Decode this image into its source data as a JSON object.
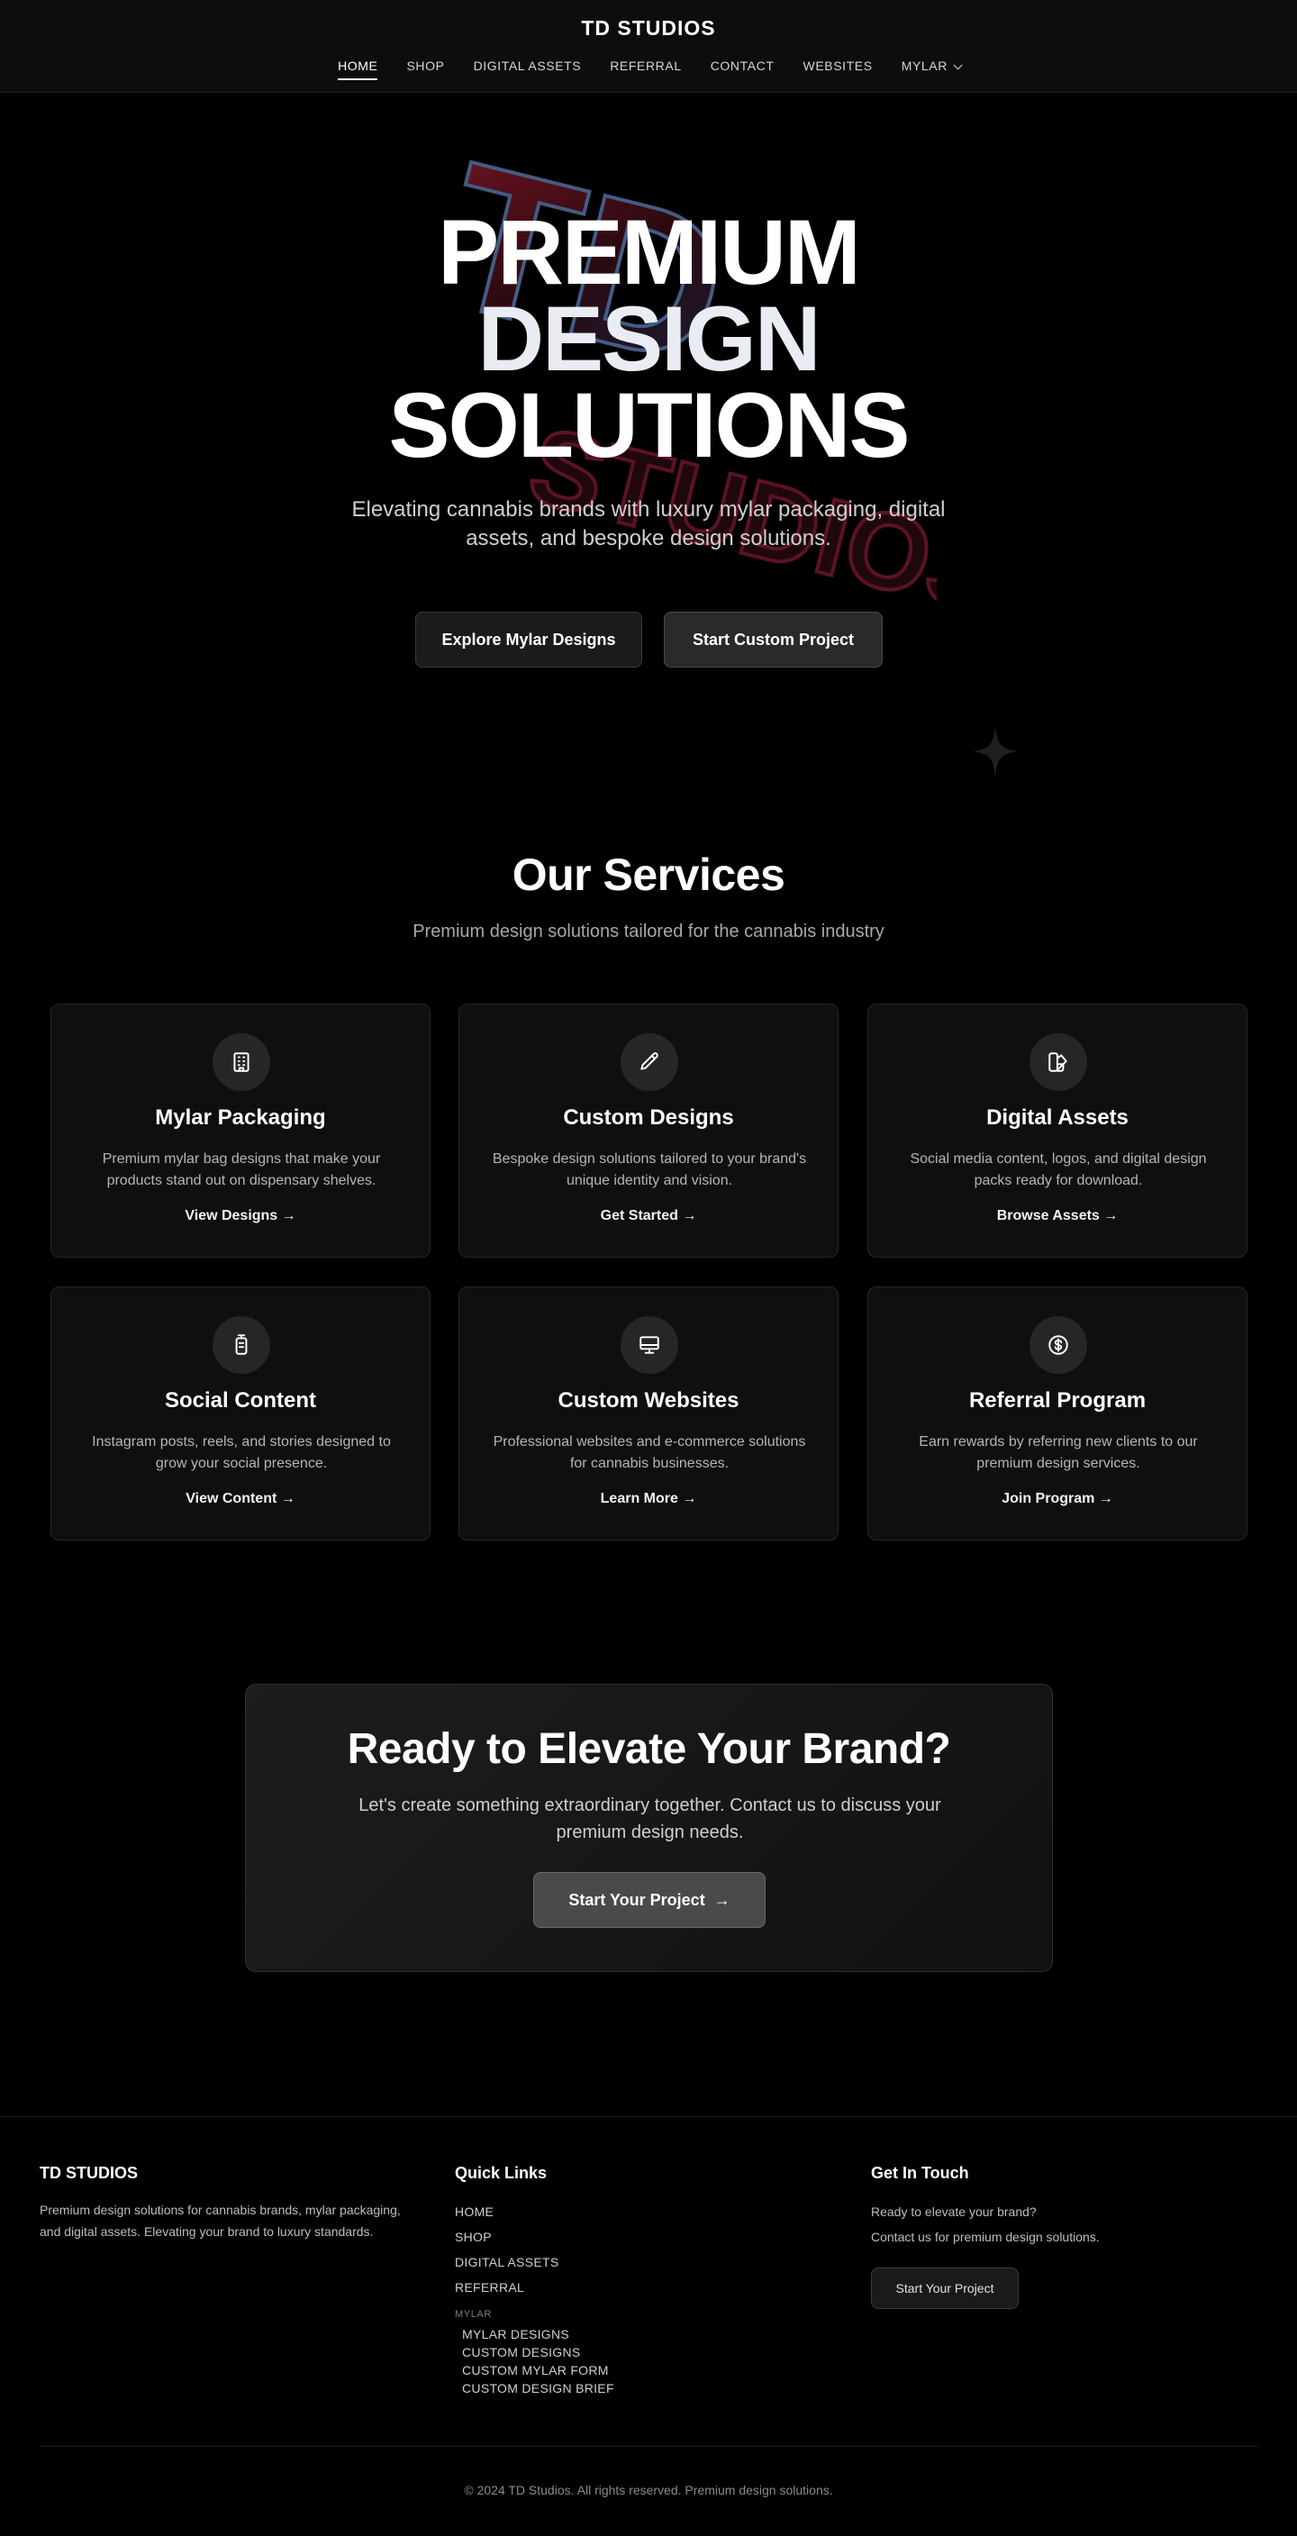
{
  "nav": {
    "brand": "TD STUDIOS",
    "links": [
      {
        "label": "HOME"
      },
      {
        "label": "SHOP"
      },
      {
        "label": "DIGITAL ASSETS"
      },
      {
        "label": "REFERRAL"
      },
      {
        "label": "CONTACT"
      },
      {
        "label": "WEBSITES"
      },
      {
        "label": "MYLAR"
      }
    ],
    "active": "HOME"
  },
  "hero": {
    "logo_text": "TD STUDIOS",
    "title_lines": [
      "PREMIUM",
      "DESIGN",
      "SOLUTIONS"
    ],
    "subtitle": "Elevating cannabis brands with luxury mylar packaging, digital assets, and bespoke design solutions.",
    "buttons": {
      "explore": "Explore Mylar Designs",
      "start": "Start Custom Project"
    }
  },
  "services": {
    "title": "Our Services",
    "subtitle": "Premium design solutions tailored for the cannabis industry",
    "cards": [
      {
        "icon": "building-icon",
        "title": "Mylar Packaging",
        "desc": "Premium mylar bag designs that make your products stand out on dispensary shelves.",
        "link": "View Designs →"
      },
      {
        "icon": "pencil-icon",
        "title": "Custom Designs",
        "desc": "Bespoke design solutions tailored to your brand's unique identity and vision.",
        "link": "Get Started →"
      },
      {
        "icon": "swatch-icon",
        "title": "Digital Assets",
        "desc": "Social media content, logos, and digital design packs ready for download.",
        "link": "Browse Assets →"
      },
      {
        "icon": "phone-icon",
        "title": "Social Content",
        "desc": "Instagram posts, reels, and stories designed to grow your social presence.",
        "link": "View Content →"
      },
      {
        "icon": "monitor-icon",
        "title": "Custom Websites",
        "desc": "Professional websites and e-commerce solutions for cannabis businesses.",
        "link": "Learn More →"
      },
      {
        "icon": "dollar-icon",
        "title": "Referral Program",
        "desc": "Earn rewards by referring new clients to our premium design services.",
        "link": "Join Program →"
      }
    ]
  },
  "cta": {
    "title": "Ready to Elevate Your Brand?",
    "text": "Let's create something extraordinary together. Contact us to discuss your premium design needs.",
    "button": "Start Your Project",
    "button_arrow": "→"
  },
  "footer": {
    "brand": "TD STUDIOS",
    "about": "Premium design solutions for cannabis brands, mylar packaging, and digital assets. Elevating your brand to luxury standards.",
    "quick_links_title": "Quick Links",
    "quick_links": [
      "HOME",
      "SHOP",
      "DIGITAL ASSETS",
      "REFERRAL"
    ],
    "mylar_group": "MYLAR",
    "mylar_links": [
      "MYLAR DESIGNS",
      "CUSTOM DESIGNS",
      "CUSTOM MYLAR FORM",
      "CUSTOM DESIGN BRIEF"
    ],
    "contact_title": "Get In Touch",
    "contact_line1": "Ready to elevate your brand?",
    "contact_line2": "Contact us for premium design solutions.",
    "contact_button": "Start Your Project",
    "copyright": "© 2024 TD Studios. All rights reserved. Premium design solutions."
  },
  "colors": {
    "background": "#000000",
    "card": "#0f0f0f",
    "text_muted": "#b5b5b5",
    "logo_red": "#8b1a2b",
    "logo_blue": "#3a5a8a"
  }
}
